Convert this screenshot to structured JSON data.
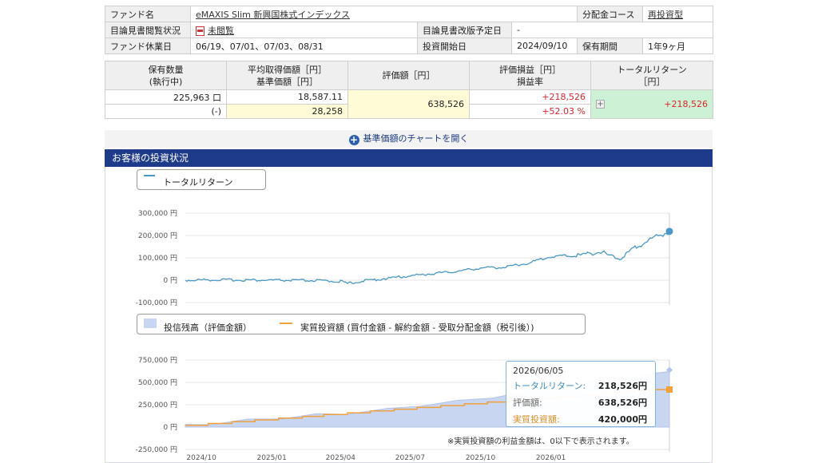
{
  "fund_info": {
    "fund_name_label": "ファンド名",
    "fund_name": "eMAXIS Slim 新興国株式インデックス",
    "dist_course_label": "分配金コース",
    "dist_course": "再投資型",
    "prospectus_status_label": "目論見書閲覧状況",
    "prospectus_status": "未閲覧",
    "prospectus_revision_label": "目論見書改版予定日",
    "prospectus_revision": "-",
    "holidays_label": "ファンド休業日",
    "holidays": "06/19、07/01、07/03、08/31",
    "start_date_label": "投資開始日",
    "start_date": "2024/09/10",
    "holding_period_label": "保有期間",
    "holding_period": "1年9ヶ月"
  },
  "holdings": {
    "headers": {
      "qty": "保有数量",
      "qty_sub": "(執行中)",
      "avg_cost": "平均取得価額［円］",
      "base_price": "基準価額［円］",
      "valuation": "評価額［円］",
      "pl": "評価損益［円］",
      "pl_rate": "損益率",
      "total_return": "トータルリターン",
      "total_return_unit": "［円］"
    },
    "qty": "225,963 口",
    "qty_pending": "(-)",
    "avg_cost": "18,587.11",
    "base_price": "28,258",
    "valuation": "638,526",
    "pl": "+218,526",
    "pl_rate": "+52.03 %",
    "total_return": "+218,526",
    "expand_icon": "plus-square-icon"
  },
  "chart_toggle": {
    "label": "基準価額のチャートを開く",
    "icon": "plus-circle-icon"
  },
  "section": {
    "title": "お客様の投資状況"
  },
  "colors": {
    "header_bg": "#1e3a8a",
    "return_line": "#4a97c6",
    "balance_area": "#c9d6f1",
    "invested_line": "#f0a03c",
    "gain_red": "#d8262b",
    "highlight_green": "#cdf1d5",
    "highlight_yellow": "#fffbd6"
  },
  "legend1": {
    "label": "トータルリターン"
  },
  "legend2": {
    "area_label": "投信残高（評価金額）",
    "line_label": "実質投資額 (買付金額 - 解約金額 - 受取分配金額（税引後）)"
  },
  "tooltip": {
    "date": "2026/06/05",
    "total_return_label": "トータルリターン:",
    "total_return": "218,526円",
    "valuation_label": "評価額:",
    "valuation": "638,526円",
    "invested_label": "実質投資額:",
    "invested": "420,000円"
  },
  "note": "※実質投資額の利益金額は、0以下で表示されます。",
  "chart_data": [
    {
      "type": "line",
      "series": [
        {
          "name": "トータルリターン",
          "x": [
            "2024-09-10",
            "2024-10-15",
            "2024-11-20",
            "2024-12-25",
            "2025-01-30",
            "2025-03-01",
            "2025-04-01",
            "2025-04-10",
            "2025-05-01",
            "2025-06-01",
            "2025-07-01",
            "2025-08-01",
            "2025-09-01",
            "2025-10-01",
            "2025-11-01",
            "2025-11-20",
            "2025-12-01",
            "2025-12-15",
            "2026-01-01",
            "2026-01-20",
            "2026-02-01",
            "2026-02-20",
            "2026-03-01",
            "2026-03-20",
            "2026-04-01",
            "2026-04-15",
            "2026-05-01",
            "2026-05-15",
            "2026-06-05"
          ],
          "values": [
            0,
            2000,
            1000,
            0,
            -1000,
            -2000,
            -5000,
            -15000,
            -3000,
            8000,
            20000,
            30000,
            40000,
            55000,
            58000,
            70000,
            75000,
            90000,
            105000,
            110000,
            108000,
            118000,
            130000,
            110000,
            95000,
            130000,
            165000,
            190000,
            218526
          ]
        }
      ],
      "yticks": [
        -100000,
        0,
        100000,
        200000,
        300000
      ],
      "ytick_labels": [
        "-100,000 円",
        "0 円",
        "100,000 円",
        "200,000 円",
        "300,000 円"
      ],
      "ylim": [
        -100000,
        300000
      ]
    },
    {
      "type": "area",
      "series": [
        {
          "name": "投信残高（評価金額）",
          "x": [
            "2024-09-10",
            "2024-10-15",
            "2024-12-01",
            "2025-01-15",
            "2025-03-01",
            "2025-04-10",
            "2025-06-01",
            "2025-07-15",
            "2025-09-01",
            "2025-10-15",
            "2025-12-01",
            "2026-01-15",
            "2026-03-01",
            "2026-04-01",
            "2026-05-01",
            "2026-06-05"
          ],
          "values": [
            20000,
            45000,
            80000,
            110000,
            140000,
            160000,
            200000,
            250000,
            290000,
            340000,
            390000,
            450000,
            520000,
            500000,
            580000,
            638526
          ]
        },
        {
          "name": "実質投資額 (買付金額 - 解約金額 - 受取分配金額（税引後）)",
          "x": [
            "2024-09-10",
            "2024-10-10",
            "2024-11-10",
            "2024-12-10",
            "2025-01-10",
            "2025-02-10",
            "2025-03-10",
            "2025-04-10",
            "2025-05-10",
            "2025-06-10",
            "2025-07-10",
            "2025-08-10",
            "2025-09-10",
            "2025-10-10",
            "2025-11-10",
            "2025-12-10",
            "2026-01-10",
            "2026-02-10",
            "2026-03-10",
            "2026-04-10",
            "2026-05-10",
            "2026-06-05"
          ],
          "values": [
            20000,
            40000,
            60000,
            80000,
            100000,
            120000,
            140000,
            160000,
            180000,
            200000,
            220000,
            240000,
            260000,
            280000,
            300000,
            320000,
            340000,
            360000,
            380000,
            400000,
            420000,
            420000
          ]
        }
      ],
      "yticks": [
        -250000,
        0,
        250000,
        500000,
        750000
      ],
      "ytick_labels": [
        "-250,000 円",
        "0 円",
        "250,000 円",
        "500,000 円",
        "750,000 円"
      ],
      "ylim": [
        -250000,
        750000
      ],
      "xtick_labels": [
        "2024/10",
        "2025/01",
        "2025/04",
        "2025/07",
        "2025/10",
        "2026/01"
      ],
      "xticks": [
        "2024-10-01",
        "2025-01-01",
        "2025-04-01",
        "2025-07-01",
        "2025-10-01",
        "2026-01-01"
      ]
    }
  ]
}
